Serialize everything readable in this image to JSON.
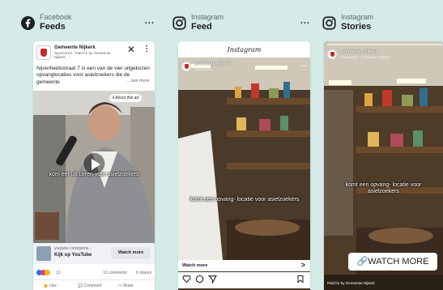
{
  "colors": {
    "background": "#d4ebe7",
    "facebook_blue": "#1877f2",
    "ad_red": "#c62828"
  },
  "columns": [
    {
      "platform": "Facebook",
      "placement": "Feeds",
      "icon": "facebook-icon",
      "more": "..."
    },
    {
      "platform": "Instagram",
      "placement": "Feed",
      "icon": "instagram-icon",
      "more": "..."
    },
    {
      "platform": "Instagram",
      "placement": "Stories",
      "icon": "instagram-icon",
      "more": "..."
    }
  ],
  "facebook_preview": {
    "page_name": "Gemeente Nijkerk",
    "sponsored": "Sponsored · Paid for by Gemeente Nijkerk · ·",
    "close": "✕",
    "kebab": "⋮",
    "body_text": "Nijverheidsstraat 7 is een van de vier uitgekozen opvanglocaties voor asielzoekers die de gemeente",
    "see_more": "...see more",
    "about_ad": "ℹ About this ad",
    "subtitle": "kom eer uit Leren voor asielzoekers",
    "link_domain": "youtube.com/geme...",
    "link_title": "Kijk op YouTube",
    "cta": "Watch more",
    "reaction_count": "13",
    "comments": "13 comments",
    "shares": "6 shares",
    "actions": [
      "Like",
      "Comment",
      "Share"
    ]
  },
  "instagram_feed_preview": {
    "wordmark": "Instagram",
    "username": "gemeente_nijkerk",
    "sponsored": "Sponsored",
    "dots": "...",
    "subtitle": "komt een opvang- locatie voor asielzoekers",
    "cta": "Watch more",
    "cta_arrow": ">",
    "icons": [
      "heart-icon",
      "comment-icon",
      "send-icon",
      "bookmark-icon"
    ]
  },
  "instagram_story_preview": {
    "username": "gemeente_nijkerk",
    "sponsored": "Sponsored · Gemeente Nijkerk",
    "subtitle": "komt een opvang- locatie voor asielzoekers",
    "cta": "WATCH MORE",
    "paid_by": "Paid for by Gemeente Nijkerk"
  }
}
